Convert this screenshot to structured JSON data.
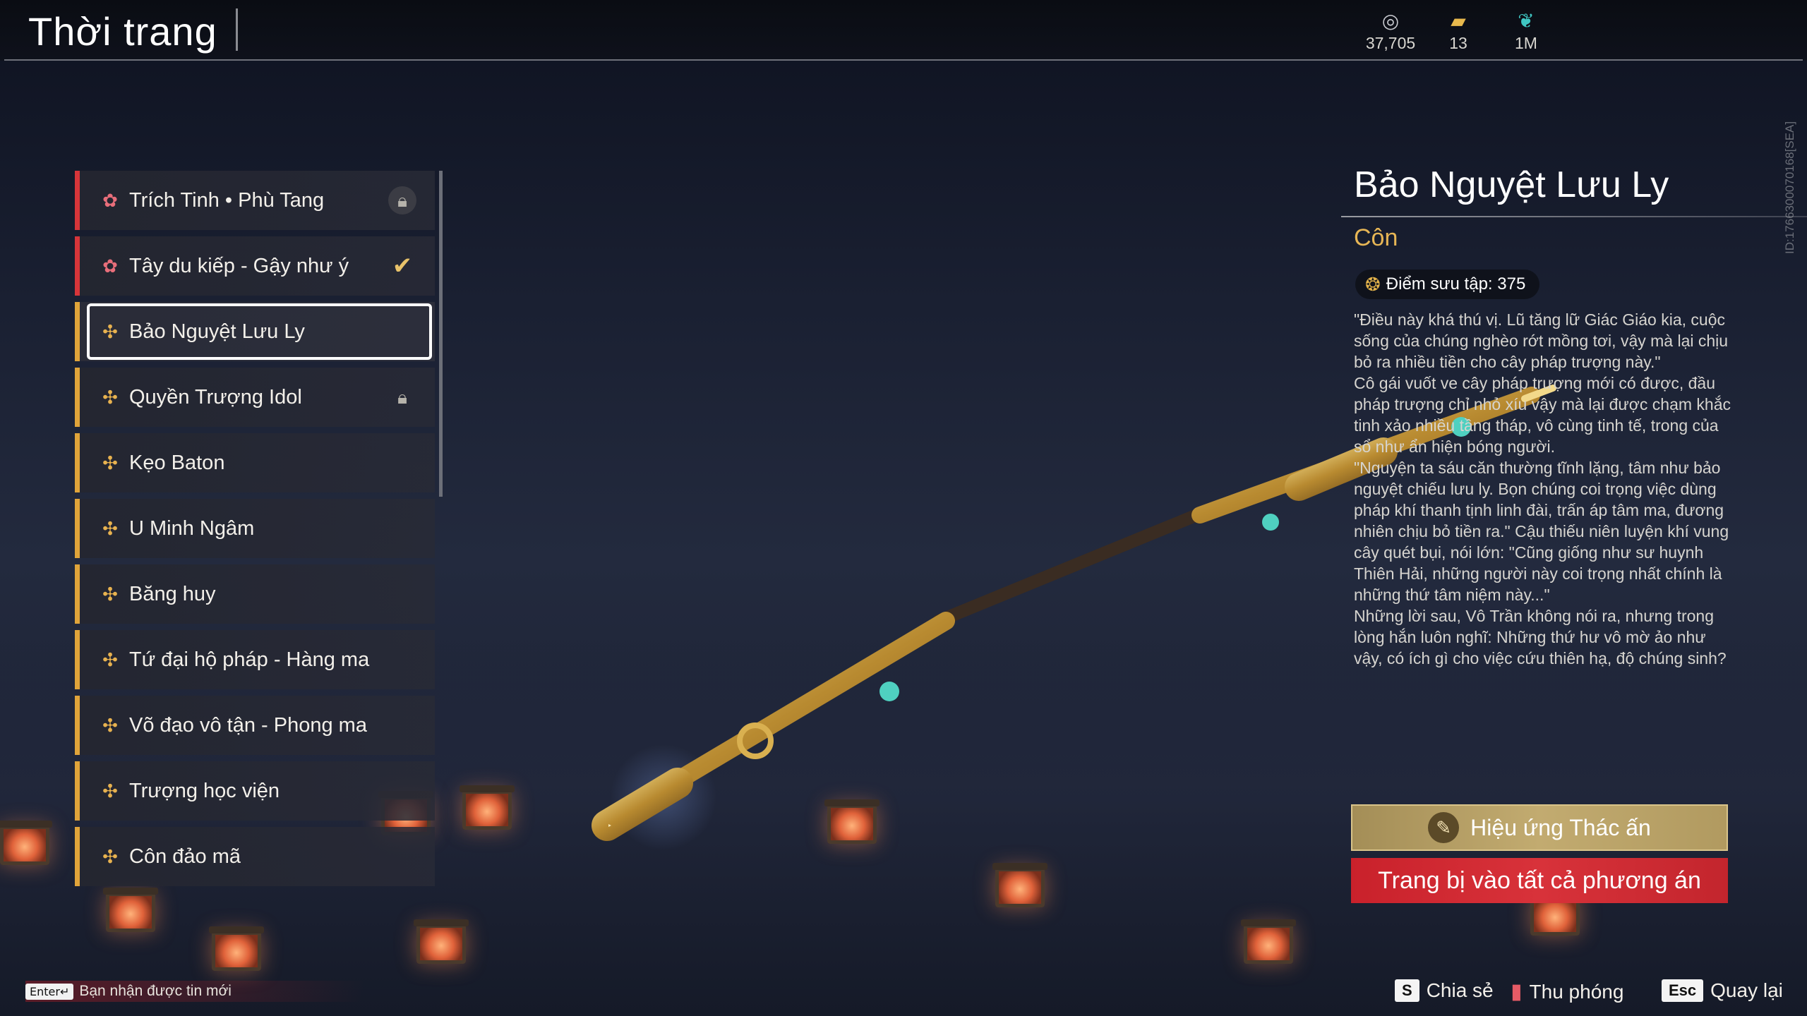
{
  "header": {
    "title": "Thời trang",
    "currencies": [
      {
        "icon": "silver-coin-icon",
        "value": "37,705"
      },
      {
        "icon": "gold-ingot-icon",
        "value": "13"
      },
      {
        "icon": "jade-feather-icon",
        "value": "1M"
      }
    ]
  },
  "side_id": "ID:1766300070168[SEA]",
  "list": {
    "items": [
      {
        "label": "Trích Tinh • Phù Tang",
        "status": "locked"
      },
      {
        "label": "Tây du kiếp - Gậy như ý",
        "status": "equipped"
      },
      {
        "label": "Bảo Nguyệt Lưu Ly",
        "status": "selected"
      },
      {
        "label": "Quyền Trượng Idol",
        "status": "locked"
      },
      {
        "label": "Kẹo Baton",
        "status": ""
      },
      {
        "label": "U Minh Ngâm",
        "status": ""
      },
      {
        "label": "Băng huy",
        "status": ""
      },
      {
        "label": "Tứ đại hộ pháp - Hàng ma",
        "status": ""
      },
      {
        "label": "Võ đạo vô tận - Phong ma",
        "status": ""
      },
      {
        "label": "Trượng học viện",
        "status": ""
      },
      {
        "label": "Côn đảo mã",
        "status": ""
      }
    ]
  },
  "detail": {
    "name": "Bảo Nguyệt Lưu Ly",
    "type": "Côn",
    "points_label": "Điểm sưu tập: 375",
    "description": "\"Điều này khá thú vị. Lũ tăng lữ Giác Giáo kia, cuộc sống của chúng nghèo rớt mồng tơi, vậy mà lại chịu bỏ ra nhiều tiền cho cây pháp trượng này.\"\nCô gái vuốt ve cây pháp trượng mới có được, đầu pháp trượng chỉ nhỏ xíu vậy mà lại được chạm khắc tinh xảo nhiều tầng tháp, vô cùng tinh tế, trong của sổ như ẩn hiện bóng người.\n\"Nguyện ta sáu căn thường tĩnh lặng, tâm như bảo nguyệt chiếu lưu ly. Bọn chúng coi trọng việc dùng pháp khí thanh tịnh linh đài, trấn áp tâm ma, đương nhiên chịu bỏ tiền ra.\" Cậu thiếu niên luyện khí vung cây quét bụi, nói lớn: \"Cũng giống như sư huynh Thiên Hải, những người này coi trọng nhất chính là những thứ tâm niệm này...\"\nNhững lời sau, Vô Trần không nói ra, nhưng trong lòng hắn luôn nghĩ: Những thứ hư vô mờ ảo như vậy, có ích gì cho việc cứu thiên hạ, độ chúng sinh?"
  },
  "buttons": {
    "effect": "Hiệu ứng Thác ấn",
    "equip_all": "Trang bị vào tất cả phương án"
  },
  "footer": {
    "notify_key": "Enter↵",
    "notify_text": "Bạn nhận được tin mới",
    "hints": [
      {
        "key": "S",
        "label": "Chia sẻ"
      },
      {
        "key": "",
        "label": "Thu phóng"
      },
      {
        "key": "Esc",
        "label": "Quay lại"
      }
    ]
  },
  "colors": {
    "accent_red": "#d7353a",
    "accent_gold": "#e0a43a",
    "button_gold": "#b19a60",
    "button_red": "#d8323a"
  }
}
